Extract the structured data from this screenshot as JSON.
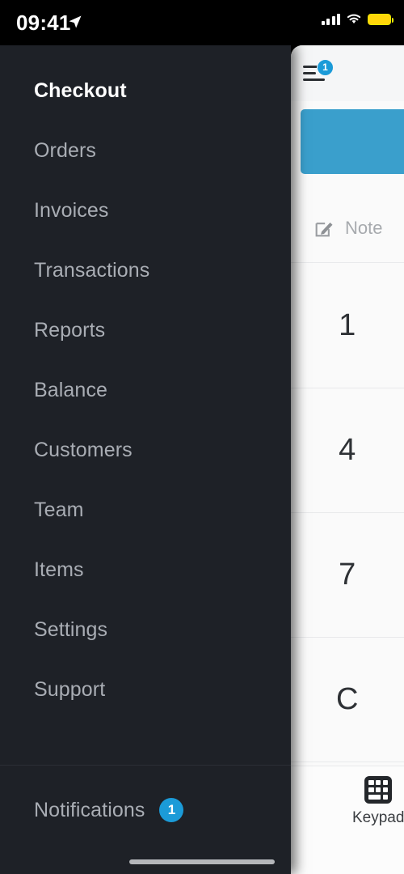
{
  "status_bar": {
    "time": "09:41",
    "location_icon": "location-arrow-icon",
    "cellular_icon": "cellular-signal-icon",
    "wifi_icon": "wifi-icon",
    "battery_icon": "battery-icon",
    "battery_color": "#ffd60a"
  },
  "sidebar": {
    "background_color": "#1e2127",
    "active_item_color": "#ffffff",
    "item_color": "#a9adb4",
    "items": [
      {
        "label": "Checkout",
        "active": true
      },
      {
        "label": "Orders",
        "active": false
      },
      {
        "label": "Invoices",
        "active": false
      },
      {
        "label": "Transactions",
        "active": false
      },
      {
        "label": "Reports",
        "active": false
      },
      {
        "label": "Balance",
        "active": false
      },
      {
        "label": "Customers",
        "active": false
      },
      {
        "label": "Team",
        "active": false
      },
      {
        "label": "Items",
        "active": false
      },
      {
        "label": "Settings",
        "active": false
      },
      {
        "label": "Support",
        "active": false
      }
    ],
    "notifications": {
      "label": "Notifications",
      "badge_count": "1",
      "badge_color": "#1b9bd8"
    }
  },
  "panel": {
    "header": {
      "menu_icon": "hamburger-menu-icon",
      "menu_badge_count": "1",
      "menu_badge_color": "#1b9bd8"
    },
    "amount_card": {
      "color": "#3a9fcc"
    },
    "note": {
      "icon": "note-pencil-icon",
      "placeholder": "Note"
    },
    "keypad": {
      "keys": [
        "1",
        "4",
        "7",
        "C"
      ]
    },
    "tabbar": {
      "tabs": [
        {
          "label": "Keypad",
          "icon": "keypad-grid-icon",
          "active": true
        }
      ]
    }
  }
}
